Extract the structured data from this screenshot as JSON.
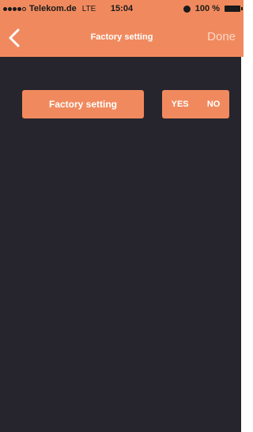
{
  "status_bar": {
    "carrier": "Telekom.de",
    "network": "LTE",
    "time": "15:04",
    "battery": "100 %",
    "icons": [
      "signal-dots-icon",
      "alarm-icon",
      "battery-icon"
    ]
  },
  "nav": {
    "title": "Factory setting",
    "done_label": "Done",
    "back_icon": "chevron-left-icon"
  },
  "main": {
    "factory_button_label": "Factory setting",
    "yes_label": "YES",
    "no_label": "NO"
  },
  "colors": {
    "accent": "#f08a5e",
    "background": "#26252e",
    "text_light": "#ffffff",
    "done_text": "#fbd6c6"
  }
}
